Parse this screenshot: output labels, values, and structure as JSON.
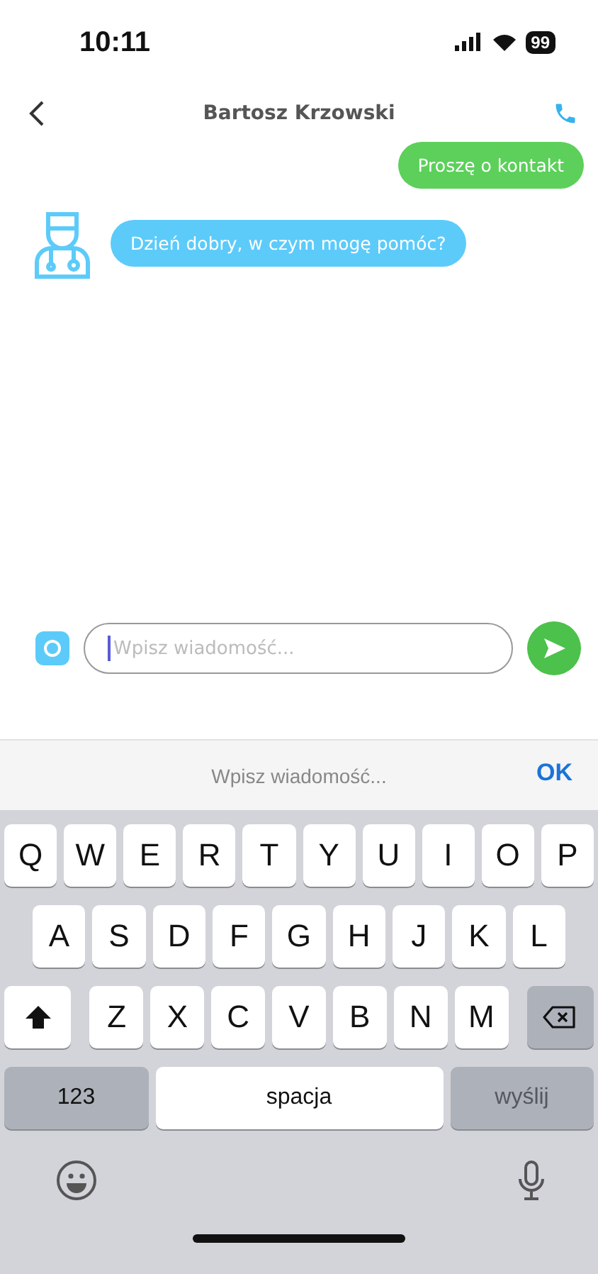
{
  "status_bar": {
    "time": "10:11",
    "battery": "99"
  },
  "header": {
    "title": "Bartosz Krzowski"
  },
  "messages": [
    {
      "kind": "outgoing",
      "text": "Proszę o kontakt"
    },
    {
      "kind": "incoming",
      "text": "Dzień dobry, w czym mogę pomóc?"
    }
  ],
  "composer": {
    "placeholder": "Wpisz wiadomość...",
    "focused": true
  },
  "accessory_bar": {
    "hint": "Wpisz wiadomość...",
    "done": "OK"
  },
  "keyboard": {
    "top_row": [
      {
        "kind": "letter",
        "label": "Q"
      },
      {
        "kind": "letter",
        "label": "W"
      },
      {
        "kind": "letter",
        "label": "E"
      },
      {
        "kind": "letter",
        "label": "R"
      },
      {
        "kind": "letter",
        "label": "T"
      },
      {
        "kind": "letter",
        "label": "Y"
      },
      {
        "kind": "letter",
        "label": "U"
      },
      {
        "kind": "letter",
        "label": "I"
      },
      {
        "kind": "letter",
        "label": "O"
      },
      {
        "kind": "letter",
        "label": "P"
      }
    ],
    "middle_row": [
      {
        "kind": "letter",
        "label": "A"
      },
      {
        "kind": "letter",
        "label": "S"
      },
      {
        "kind": "letter",
        "label": "D"
      },
      {
        "kind": "letter",
        "label": "F"
      },
      {
        "kind": "letter",
        "label": "G"
      },
      {
        "kind": "letter",
        "label": "H"
      },
      {
        "kind": "letter",
        "label": "J"
      },
      {
        "kind": "letter",
        "label": "K"
      },
      {
        "kind": "letter",
        "label": "L"
      }
    ],
    "bottom_row": [
      {
        "kind": "shift"
      },
      {
        "kind": "letter",
        "label": "Z"
      },
      {
        "kind": "letter",
        "label": "X"
      },
      {
        "kind": "letter",
        "label": "C"
      },
      {
        "kind": "letter",
        "label": "V"
      },
      {
        "kind": "letter",
        "label": "B"
      },
      {
        "kind": "letter",
        "label": "N"
      },
      {
        "kind": "letter",
        "label": "M"
      },
      {
        "kind": "backspace"
      }
    ],
    "function_row": [
      {
        "kind": "mode",
        "label": "123"
      },
      {
        "kind": "space",
        "label": "spacja"
      },
      {
        "kind": "send",
        "label": "wyślij",
        "disabled": true
      }
    ]
  }
}
